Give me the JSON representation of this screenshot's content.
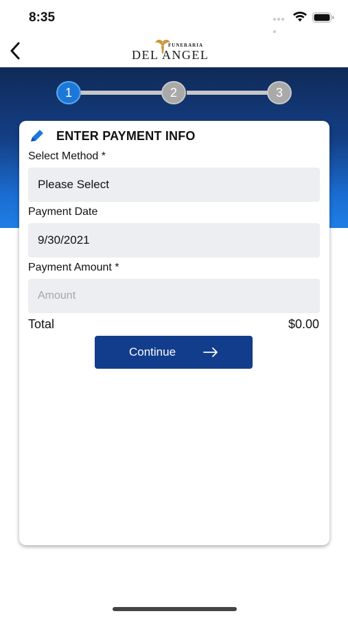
{
  "status_bar": {
    "time": "8:35"
  },
  "nav": {
    "logo_small": "FUNERARIA",
    "logo_main": "DEL ANGEL"
  },
  "stepper": {
    "steps": [
      "1",
      "2",
      "3"
    ],
    "active_step": 1
  },
  "card": {
    "title": "ENTER PAYMENT INFO",
    "method": {
      "label": "Select Method *",
      "value": "Please Select"
    },
    "date": {
      "label": "Payment Date",
      "value": "9/30/2021"
    },
    "amount": {
      "label": "Payment Amount *",
      "placeholder": "Amount"
    },
    "total": {
      "label": "Total",
      "value": "$0.00"
    },
    "continue_label": "Continue"
  },
  "colors": {
    "accent": "#123d8c",
    "active_step": "#1c78d8",
    "inactive_step": "#a9a9a9",
    "field_bg": "#eceef1",
    "pencil": "#1c78d8"
  },
  "icons": {
    "back": "chevron-left-icon",
    "pencil": "pencil-icon",
    "arrow": "arrow-right-icon",
    "wifi": "wifi-icon",
    "battery": "battery-icon"
  }
}
